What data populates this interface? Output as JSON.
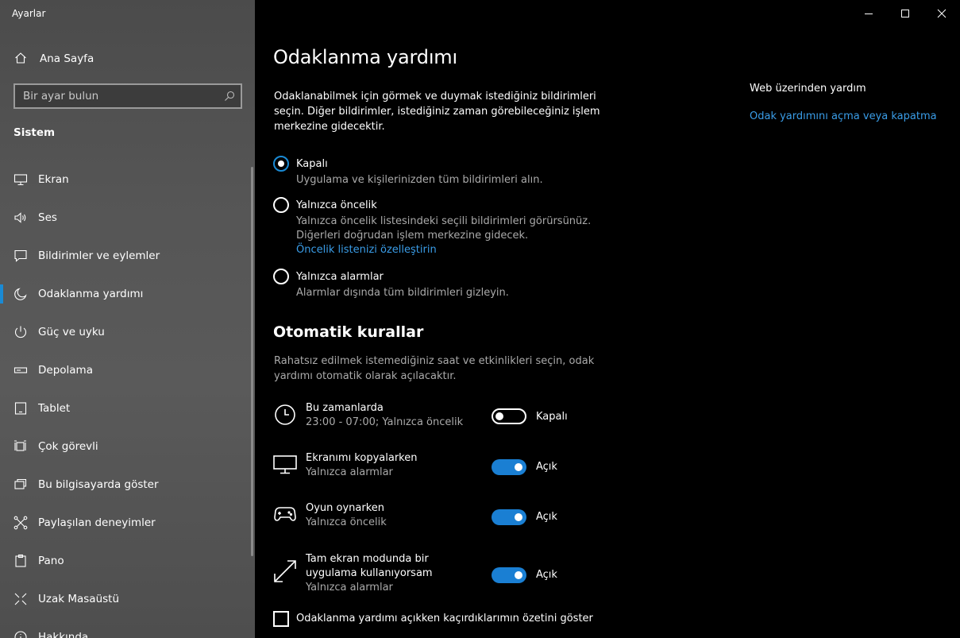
{
  "app": {
    "title": "Ayarlar"
  },
  "sidebar": {
    "home_label": "Ana Sayfa",
    "search_placeholder": "Bir ayar bulun",
    "section_title": "Sistem",
    "items": [
      {
        "label": "Ekran",
        "icon": "monitor-icon"
      },
      {
        "label": "Ses",
        "icon": "speaker-icon"
      },
      {
        "label": "Bildirimler ve eylemler",
        "icon": "notification-icon"
      },
      {
        "label": "Odaklanma yardımı",
        "icon": "moon-icon",
        "active": true
      },
      {
        "label": "Güç ve uyku",
        "icon": "power-icon"
      },
      {
        "label": "Depolama",
        "icon": "storage-icon"
      },
      {
        "label": "Tablet",
        "icon": "tablet-icon"
      },
      {
        "label": "Çok görevli",
        "icon": "multitask-icon"
      },
      {
        "label": "Bu bilgisayarda göster",
        "icon": "project-icon"
      },
      {
        "label": "Paylaşılan deneyimler",
        "icon": "shared-icon"
      },
      {
        "label": "Pano",
        "icon": "clipboard-icon"
      },
      {
        "label": "Uzak Masaüstü",
        "icon": "remote-desktop-icon"
      },
      {
        "label": "Hakkında",
        "icon": "info-icon"
      }
    ]
  },
  "main": {
    "title": "Odaklanma yardımı",
    "intro": "Odaklanabilmek için görmek ve duymak istediğiniz bildirimleri seçin. Diğer bildirimler, istediğiniz zaman görebileceğiniz işlem merkezine gidecektir.",
    "options": [
      {
        "label": "Kapalı",
        "desc": "Uygulama ve kişilerinizden tüm bildirimleri alın.",
        "checked": true
      },
      {
        "label": "Yalnızca öncelik",
        "desc": "Yalnızca öncelik listesindeki seçili bildirimleri görürsünüz. Diğerleri doğrudan işlem merkezine gidecek.",
        "link": "Öncelik listenizi özelleştirin",
        "checked": false
      },
      {
        "label": "Yalnızca alarmlar",
        "desc": "Alarmlar dışında tüm bildirimleri gizleyin.",
        "checked": false
      }
    ],
    "rules_title": "Otomatik kurallar",
    "rules_desc": "Rahatsız edilmek istemediğiniz saat ve etkinlikleri seçin, odak yardımı otomatik olarak açılacaktır.",
    "rules": [
      {
        "title": "Bu zamanlarda",
        "sub": "23:00 - 07:00; Yalnızca öncelik",
        "state": "Kapalı",
        "on": false,
        "icon": "clock-icon"
      },
      {
        "title": "Ekranımı kopyalarken",
        "sub": "Yalnızca alarmlar",
        "state": "Açık",
        "on": true,
        "icon": "display-icon"
      },
      {
        "title": "Oyun oynarken",
        "sub": "Yalnızca öncelik",
        "state": "Açık",
        "on": true,
        "icon": "gamepad-icon"
      },
      {
        "title": "Tam ekran modunda bir uygulama kullanıyorsam",
        "sub": "Yalnızca alarmlar",
        "state": "Açık",
        "on": true,
        "icon": "fullscreen-icon"
      }
    ],
    "summary_checkbox": "Odaklanma yardımı açıkken kaçırdıklarımın özetini göster"
  },
  "help": {
    "title": "Web üzerinden yardım",
    "link": "Odak yardımını açma veya kapatma"
  }
}
